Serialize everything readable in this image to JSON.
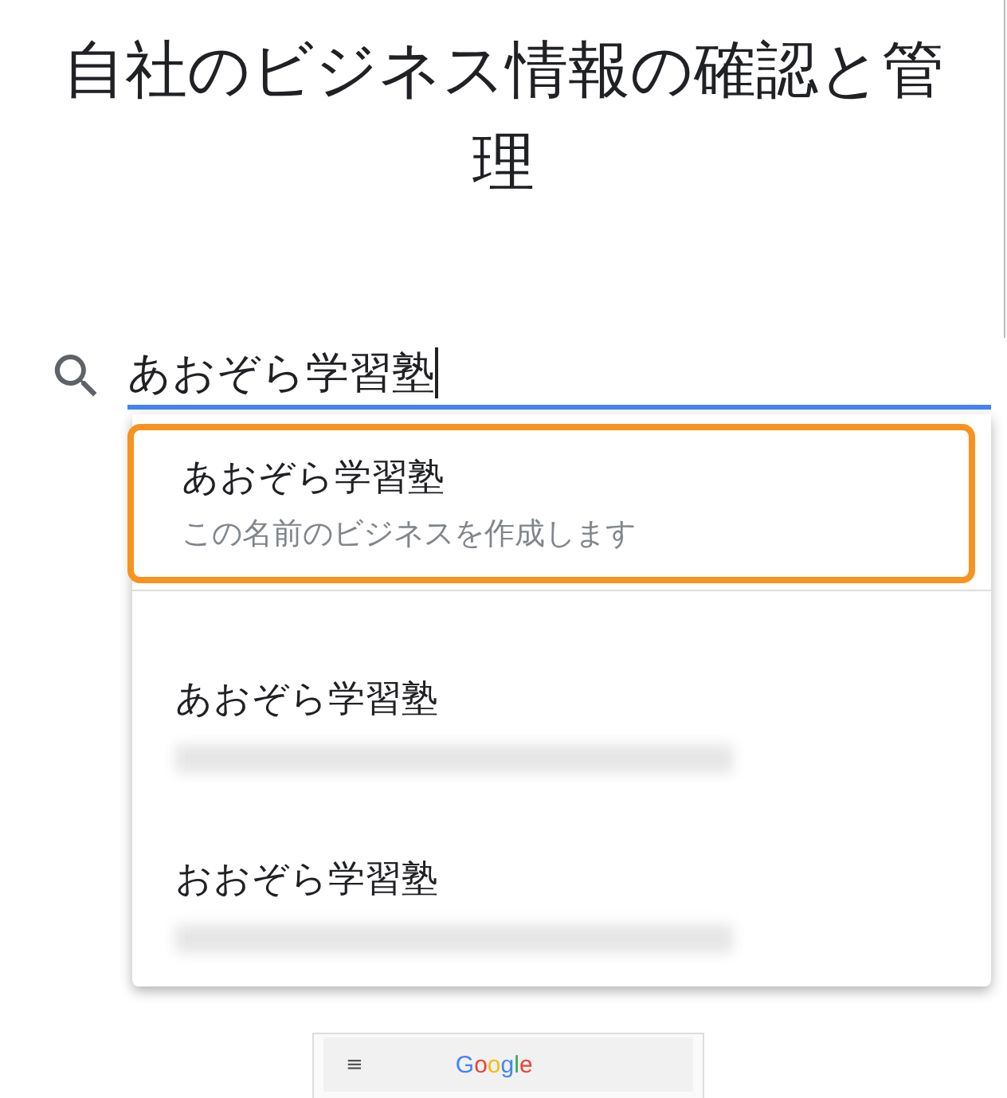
{
  "title": "自社のビジネス情報の確認と管理",
  "search": {
    "value": "あおぞら学習塾",
    "focused": true
  },
  "suggestions": [
    {
      "kind": "create",
      "name": "あおぞら学習塾",
      "subtitle": "この名前のビジネスを作成します",
      "selected": true
    },
    {
      "kind": "existing",
      "name": "あおぞら学習塾",
      "selected": false
    },
    {
      "kind": "existing",
      "name": "おおぞら学習塾",
      "selected": false
    }
  ],
  "preview": {
    "menu": "≡",
    "logo": "Google"
  }
}
